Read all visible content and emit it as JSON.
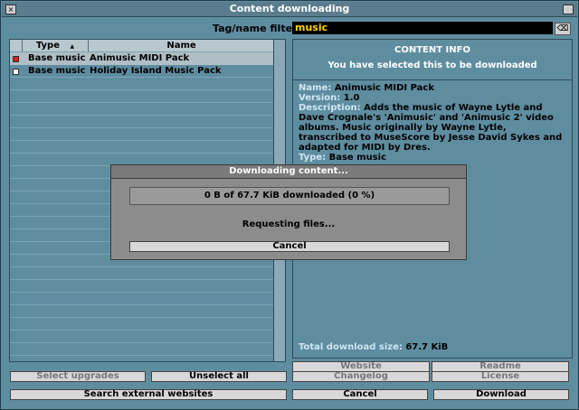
{
  "window": {
    "title": "Content downloading"
  },
  "filter": {
    "label": "Tag/name filter:",
    "value": "music",
    "clear_icon": "⌫"
  },
  "list": {
    "columns": [
      "Type",
      "Name"
    ],
    "sort_indicator": "▲",
    "rows": [
      {
        "type": "Base music",
        "name": "Animusic MIDI Pack",
        "selected": true
      },
      {
        "type": "Base music",
        "name": "Holiday Island Music Pack",
        "selected": false
      }
    ]
  },
  "info": {
    "header": "CONTENT INFO",
    "subheader": "You have selected this to be downloaded",
    "name_label": "Name:",
    "name": "Animusic MIDI Pack",
    "version_label": "Version:",
    "version": "1.0",
    "description_label": "Description:",
    "description": "Adds the music of Wayne Lytle and Dave Crognale's 'Animusic' and 'Animusic 2' video albums. Music originally by Wayne Lytle, transcribed to MuseScore by Jesse David Sykes and adapted for MIDI by Dres.",
    "type_label": "Type:",
    "type": "Base music",
    "total_label": "Total download size:",
    "total": "67.7 KiB"
  },
  "buttons": {
    "select_upgrades": "Select upgrades",
    "unselect_all": "Unselect all",
    "search_external": "Search external websites",
    "website": "Website",
    "readme": "Readme",
    "changelog": "Changelog",
    "license": "License",
    "cancel": "Cancel",
    "download": "Download"
  },
  "dialog": {
    "title": "Downloading content...",
    "progress_text": "0 B of 67.7 KiB downloaded (0 %)",
    "progress_fraction": 0,
    "status": "Requesting files...",
    "cancel": "Cancel"
  }
}
